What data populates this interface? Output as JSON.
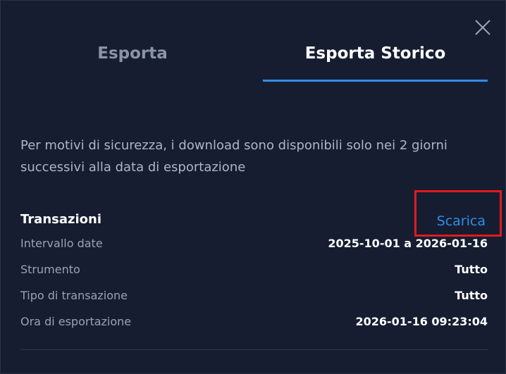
{
  "tabs": {
    "export_label": "Esporta",
    "history_label": "Esporta Storico"
  },
  "notice": "Per motivi di sicurezza, i download sono disponibili solo nei 2 giorni successivi alla data di esportazione",
  "export_item": {
    "title": "Transazioni",
    "download_label": "Scarica",
    "fields": [
      {
        "label": "Intervallo date",
        "value": "2025-10-01 a 2026-01-16"
      },
      {
        "label": "Strumento",
        "value": "Tutto"
      },
      {
        "label": "Tipo di transazione",
        "value": "Tutto"
      },
      {
        "label": "Ora di esportazione",
        "value": "2026-01-16 09:23:04"
      }
    ]
  },
  "colors": {
    "background": "#161d31",
    "accent": "#2f8ee8",
    "highlight_box": "#e01a1f"
  },
  "icons": {
    "close": "close-icon"
  }
}
